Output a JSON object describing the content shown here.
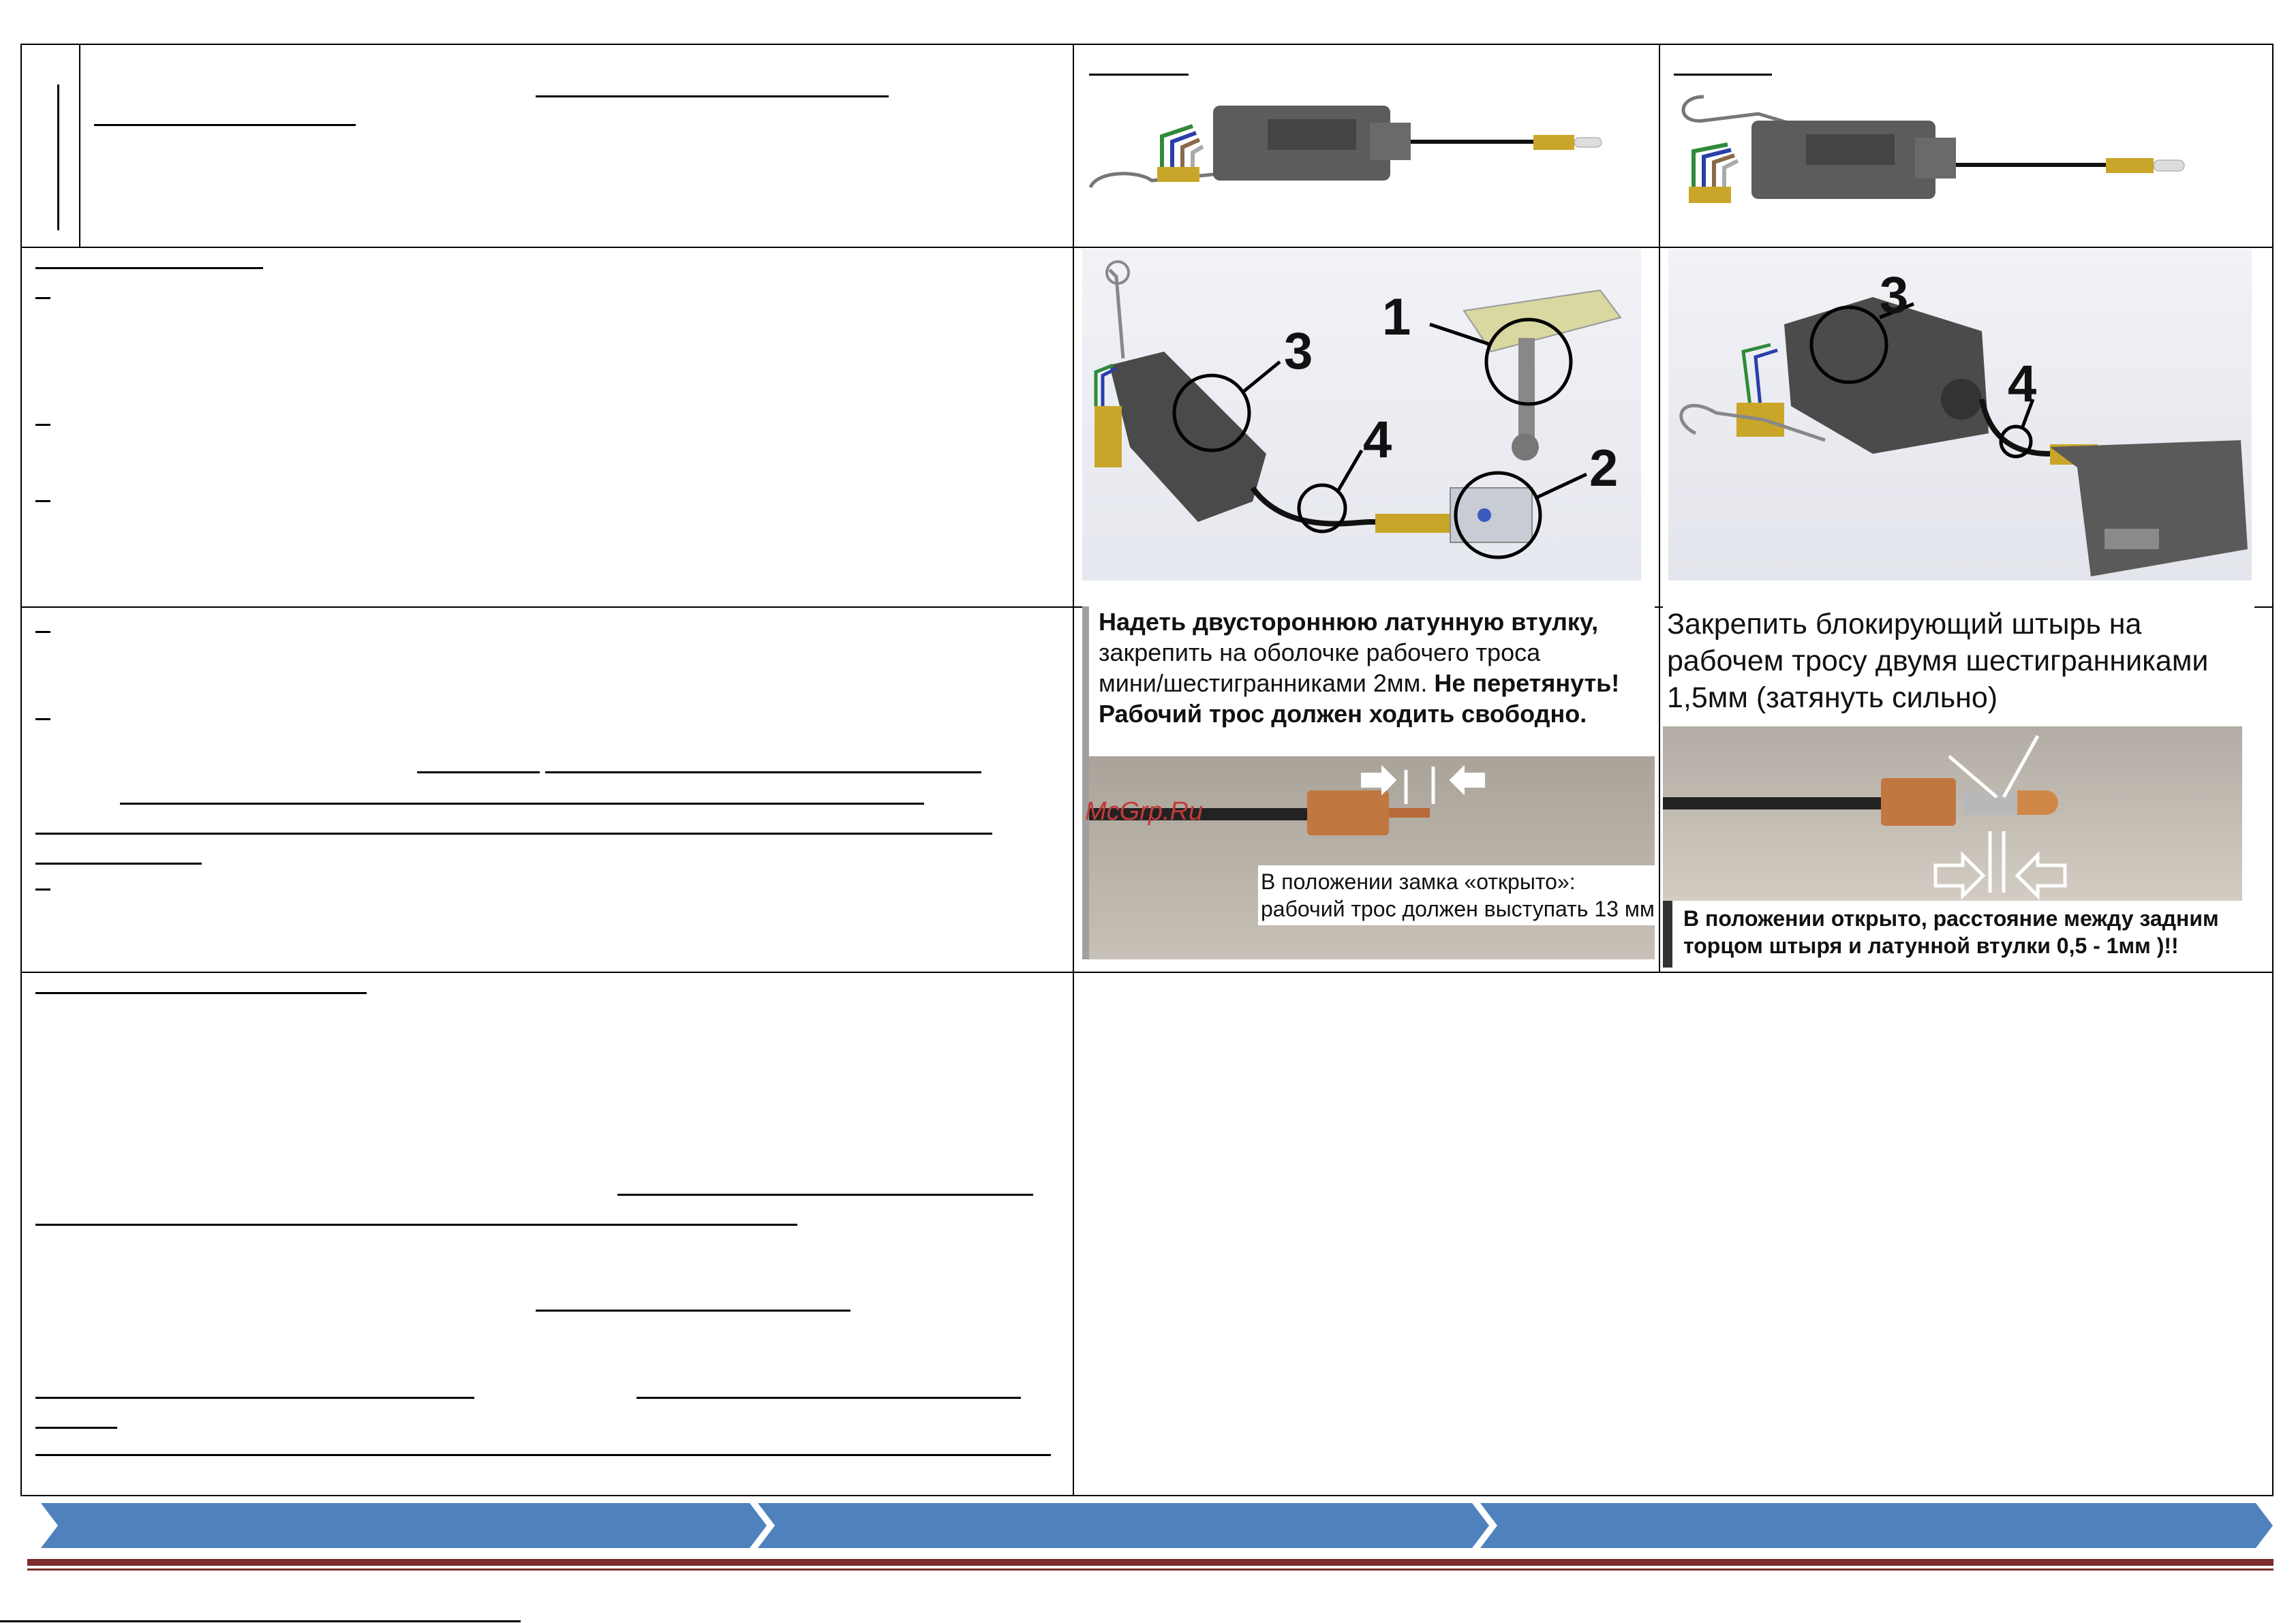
{
  "cells": {
    "assembly_photo_left": {
      "caption_line1_bold": "Надеть двустороннюю латунную втулку,",
      "caption_line2": "закрепить на оболочке рабочего троса",
      "caption_line3a": "мини/шестигранниками 2мм. ",
      "caption_line3b_bold": "Не перетянуть!",
      "caption_line4_bold": "Рабочий трос должен ходить свободно.",
      "bottom_line1": "В положении замка «открыто»:",
      "bottom_line2": "рабочий трос должен выступать 13 мм",
      "watermark": "McGrp.Ru"
    },
    "assembly_photo_right": {
      "caption_line1": "Закрепить блокирующий штырь на",
      "caption_line2": "рабочем тросу двумя шестигранниками",
      "caption_line3": "1,5мм (затянуть сильно)",
      "bottom_line1": "В положении открыто, расстояние между задним",
      "bottom_line2": "торцом штыря и латунной втулки 0,5 - 1мм )!!"
    },
    "diagram_left": {
      "labels": [
        "1",
        "2",
        "3",
        "4"
      ]
    },
    "diagram_right": {
      "labels": [
        "3",
        "4"
      ]
    }
  },
  "colors": {
    "arrow_bar": "#4f81bd",
    "footer_line": "#7b2c2c"
  }
}
